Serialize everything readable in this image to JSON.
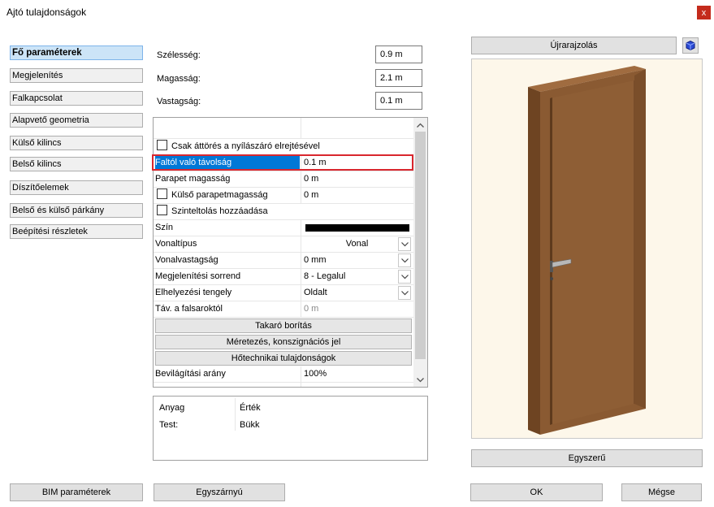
{
  "window": {
    "title": "Ajtó tulajdonságok",
    "close_label": "x"
  },
  "nav": {
    "items": [
      {
        "label": "Fő paraméterek",
        "active": true
      },
      {
        "label": "Megjelenítés"
      },
      {
        "label": "Falkapcsolat"
      },
      {
        "label": "Alapvető geometria"
      },
      {
        "label": "Külső kilincs"
      },
      {
        "label": "Belső kilincs"
      },
      {
        "label": "Díszítőelemek"
      },
      {
        "label": "Belső és külső párkány"
      },
      {
        "label": "Beépítési részletek"
      }
    ]
  },
  "fields": {
    "width": {
      "label": "Szélesség:",
      "value": "0.9 m"
    },
    "height": {
      "label": "Magasság:",
      "value": "2.1 m"
    },
    "thickness": {
      "label": "Vastagság:",
      "value": "0.1 m"
    }
  },
  "grid": {
    "only_opening": "Csak áttörés a nyílászáró elrejtésével",
    "wall_distance": {
      "label": "Faltól való távolság",
      "value": "0.1 m"
    },
    "parapet_height": {
      "label": "Parapet magasság",
      "value": "0 m"
    },
    "ext_parapet": {
      "label": "Külső parapetmagasság",
      "value": "0 m"
    },
    "leveling": "Szinteltolás hozzáadása",
    "color": {
      "label": "Szín",
      "value": "#000000"
    },
    "line_type": {
      "label": "Vonaltípus",
      "value": "Vonal"
    },
    "line_width": {
      "label": "Vonalvastagság",
      "value": "0 mm"
    },
    "draw_order": {
      "label": "Megjelenítési sorrend",
      "value": "8 - Legalul"
    },
    "placement_axis": {
      "label": "Elhelyezési tengely",
      "value": "Oldalt"
    },
    "jamb_distance": {
      "label": "Táv. a falsaroktól",
      "value": "0 m"
    },
    "cover": "Takaró borítás",
    "dimensioning": "Méretezés, konszignációs jel",
    "thermal": "Hőtechnikai tulajdonságok",
    "light_ratio": {
      "label": "Bevilágítási arány",
      "value": "100%"
    }
  },
  "materials": {
    "header_col1": "Anyag",
    "header_col2": "Érték",
    "rows": [
      {
        "name": "Test:",
        "value": "Bükk"
      }
    ]
  },
  "buttons": {
    "redraw": "Újrarajzolás",
    "simple": "Egyszerű",
    "bim": "BIM paraméterek",
    "single_leaf": "Egyszárnyú",
    "ok": "OK",
    "cancel": "Mégse"
  },
  "icons": {
    "cube": "cube-icon",
    "close": "close-icon",
    "dropdown": "chevron-down-icon"
  },
  "colors": {
    "accent_selection": "#0078d7",
    "highlight": "#d9272e",
    "door_wood": "#8a5a32"
  }
}
